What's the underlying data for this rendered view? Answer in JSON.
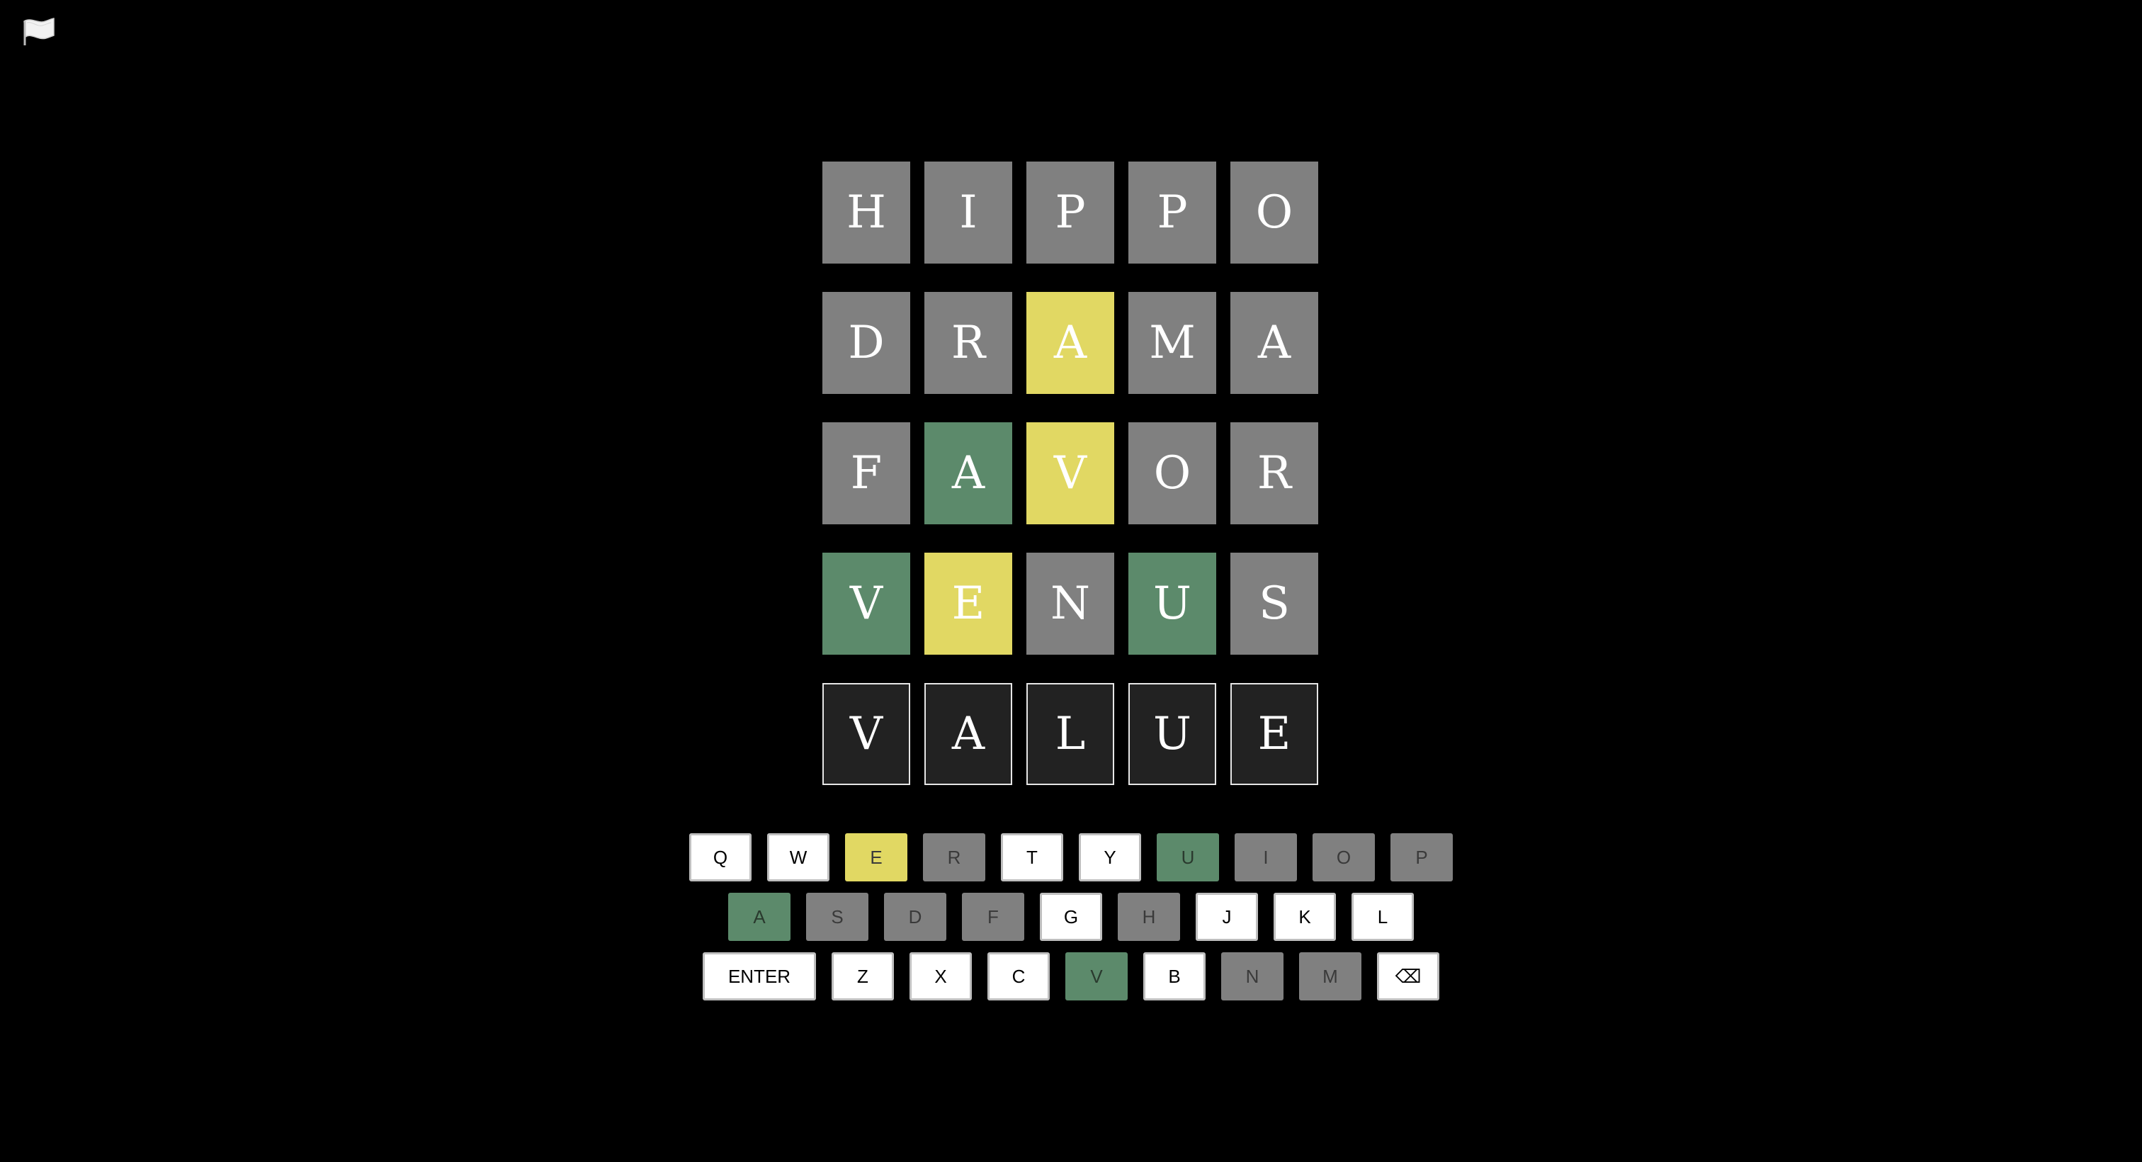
{
  "icons": {
    "flag": "white-flag-icon",
    "backspace": "backspace-icon"
  },
  "colors": {
    "absent": "#808080",
    "present": "#e1d863",
    "correct": "#5c8a6b",
    "pending": "#222222",
    "background": "#000000"
  },
  "board": {
    "rows": [
      {
        "tiles": [
          {
            "letter": "H",
            "state": "absent"
          },
          {
            "letter": "I",
            "state": "absent"
          },
          {
            "letter": "P",
            "state": "absent"
          },
          {
            "letter": "P",
            "state": "absent"
          },
          {
            "letter": "O",
            "state": "absent"
          }
        ]
      },
      {
        "tiles": [
          {
            "letter": "D",
            "state": "absent"
          },
          {
            "letter": "R",
            "state": "absent"
          },
          {
            "letter": "A",
            "state": "present"
          },
          {
            "letter": "M",
            "state": "absent"
          },
          {
            "letter": "A",
            "state": "absent"
          }
        ]
      },
      {
        "tiles": [
          {
            "letter": "F",
            "state": "absent"
          },
          {
            "letter": "A",
            "state": "correct"
          },
          {
            "letter": "V",
            "state": "present"
          },
          {
            "letter": "O",
            "state": "absent"
          },
          {
            "letter": "R",
            "state": "absent"
          }
        ]
      },
      {
        "tiles": [
          {
            "letter": "V",
            "state": "correct"
          },
          {
            "letter": "E",
            "state": "present"
          },
          {
            "letter": "N",
            "state": "absent"
          },
          {
            "letter": "U",
            "state": "correct"
          },
          {
            "letter": "S",
            "state": "absent"
          }
        ]
      },
      {
        "tiles": [
          {
            "letter": "V",
            "state": "pending"
          },
          {
            "letter": "A",
            "state": "pending"
          },
          {
            "letter": "L",
            "state": "pending"
          },
          {
            "letter": "U",
            "state": "pending"
          },
          {
            "letter": "E",
            "state": "pending"
          }
        ]
      }
    ]
  },
  "keyboard": {
    "rows": [
      {
        "keys": [
          {
            "label": "Q",
            "state": "white"
          },
          {
            "label": "W",
            "state": "white"
          },
          {
            "label": "E",
            "state": "present"
          },
          {
            "label": "R",
            "state": "absent"
          },
          {
            "label": "T",
            "state": "white"
          },
          {
            "label": "Y",
            "state": "white"
          },
          {
            "label": "U",
            "state": "correct"
          },
          {
            "label": "I",
            "state": "absent"
          },
          {
            "label": "O",
            "state": "absent"
          },
          {
            "label": "P",
            "state": "absent"
          }
        ]
      },
      {
        "keys": [
          {
            "label": "A",
            "state": "correct"
          },
          {
            "label": "S",
            "state": "absent"
          },
          {
            "label": "D",
            "state": "absent"
          },
          {
            "label": "F",
            "state": "absent"
          },
          {
            "label": "G",
            "state": "white"
          },
          {
            "label": "H",
            "state": "absent"
          },
          {
            "label": "J",
            "state": "white"
          },
          {
            "label": "K",
            "state": "white"
          },
          {
            "label": "L",
            "state": "white"
          }
        ]
      },
      {
        "keys": [
          {
            "label": "ENTER",
            "state": "white"
          },
          {
            "label": "Z",
            "state": "white"
          },
          {
            "label": "X",
            "state": "white"
          },
          {
            "label": "C",
            "state": "white"
          },
          {
            "label": "V",
            "state": "correct"
          },
          {
            "label": "B",
            "state": "white"
          },
          {
            "label": "N",
            "state": "absent"
          },
          {
            "label": "M",
            "state": "absent"
          },
          {
            "label": "⌫",
            "state": "white"
          }
        ]
      }
    ]
  }
}
